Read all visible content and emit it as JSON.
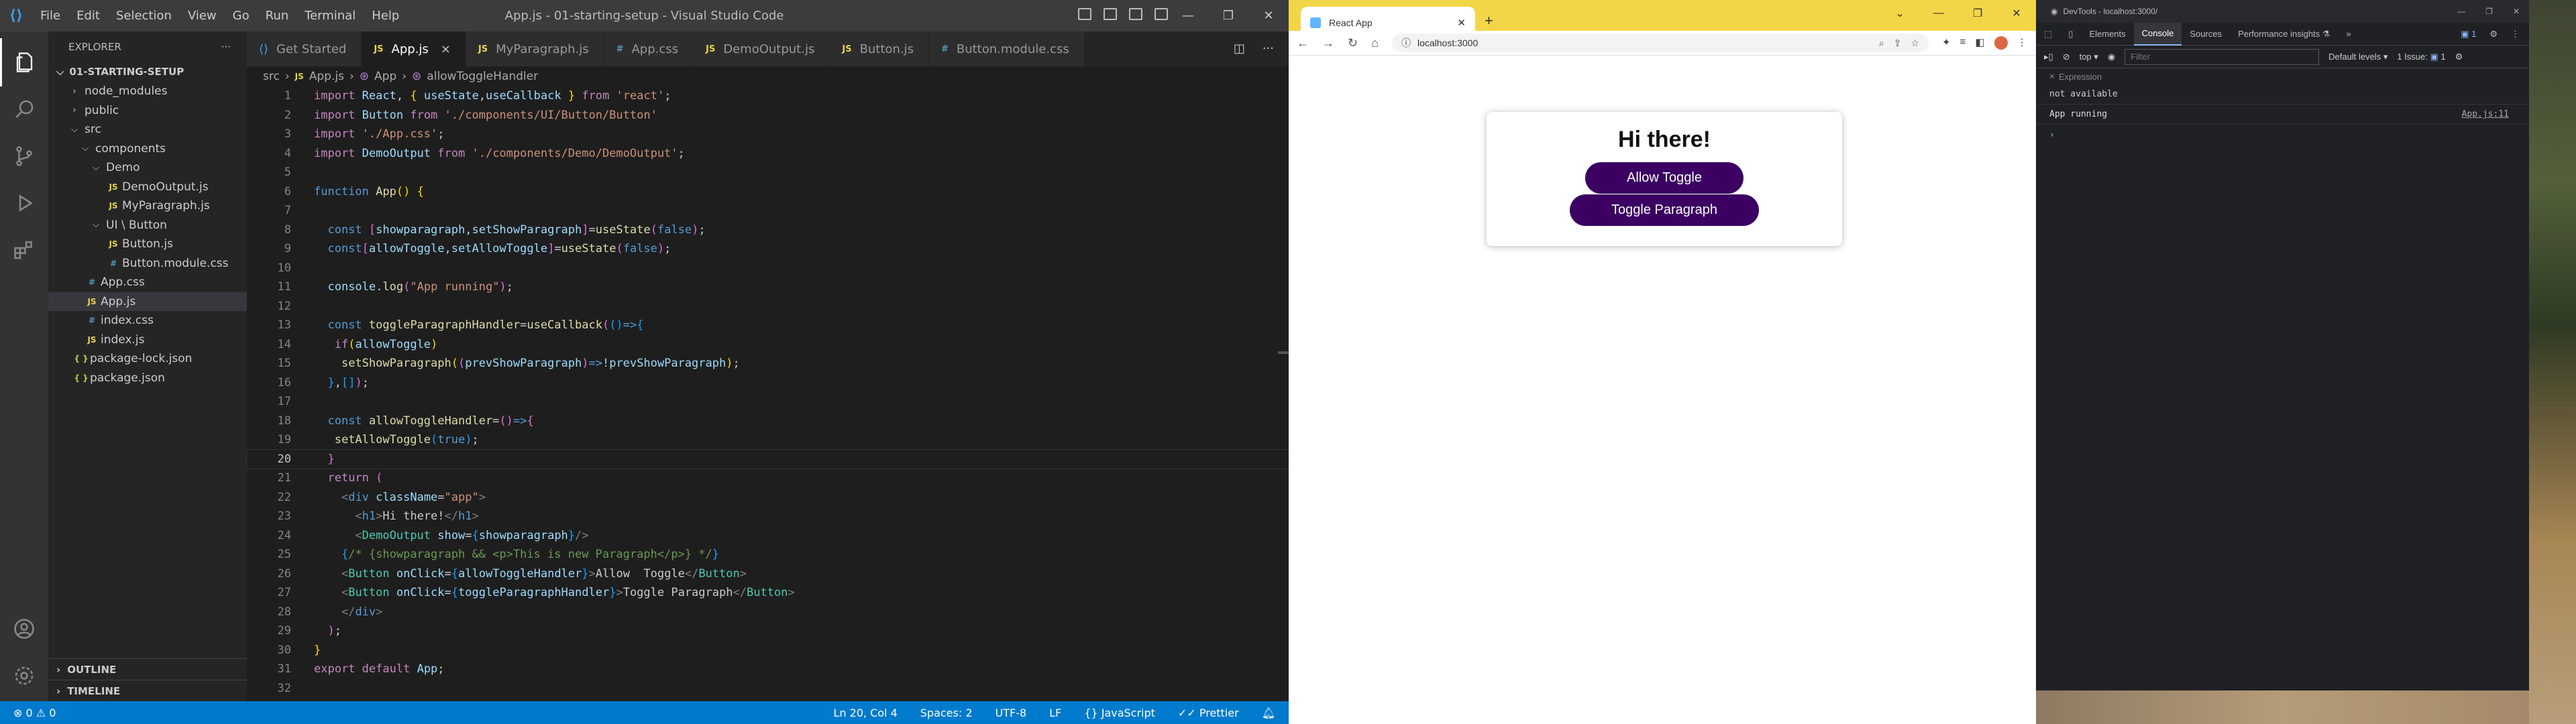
{
  "vscode": {
    "title": "App.js - 01-starting-setup - Visual Studio Code",
    "menu": [
      "File",
      "Edit",
      "Selection",
      "View",
      "Go",
      "Run",
      "Terminal",
      "Help"
    ],
    "explorer_title": "EXPLORER",
    "root_folder": "01-STARTING-SETUP",
    "tree": [
      {
        "label": "node_modules",
        "kind": "folder",
        "depth": 1,
        "open": false
      },
      {
        "label": "public",
        "kind": "folder",
        "depth": 1,
        "open": false
      },
      {
        "label": "src",
        "kind": "folder",
        "depth": 1,
        "open": true
      },
      {
        "label": "components",
        "kind": "folder",
        "depth": 2,
        "open": true
      },
      {
        "label": "Demo",
        "kind": "folder",
        "depth": 3,
        "open": true
      },
      {
        "label": "DemoOutput.js",
        "kind": "js",
        "depth": 4
      },
      {
        "label": "MyParagraph.js",
        "kind": "js",
        "depth": 4
      },
      {
        "label": "UI \\ Button",
        "kind": "folder",
        "depth": 3,
        "open": true
      },
      {
        "label": "Button.js",
        "kind": "js",
        "depth": 4
      },
      {
        "label": "Button.module.css",
        "kind": "css",
        "depth": 4
      },
      {
        "label": "App.css",
        "kind": "css",
        "depth": 2
      },
      {
        "label": "App.js",
        "kind": "js",
        "depth": 2,
        "selected": true
      },
      {
        "label": "index.css",
        "kind": "css",
        "depth": 2
      },
      {
        "label": "index.js",
        "kind": "js",
        "depth": 2
      },
      {
        "label": "package-lock.json",
        "kind": "json",
        "depth": 1
      },
      {
        "label": "package.json",
        "kind": "json",
        "depth": 1
      }
    ],
    "outline_label": "OUTLINE",
    "timeline_label": "TIMELINE",
    "tabs": [
      {
        "label": "Get Started",
        "icon": "vscode",
        "active": false
      },
      {
        "label": "App.js",
        "icon": "js",
        "active": true
      },
      {
        "label": "MyParagraph.js",
        "icon": "js",
        "active": false
      },
      {
        "label": "App.css",
        "icon": "css",
        "active": false
      },
      {
        "label": "DemoOutput.js",
        "icon": "js",
        "active": false
      },
      {
        "label": "Button.js",
        "icon": "js",
        "active": false
      },
      {
        "label": "Button.module.css",
        "icon": "css",
        "active": false
      }
    ],
    "breadcrumb": [
      "src",
      "App.js",
      "App",
      "allowToggleHandler"
    ],
    "current_line": 20,
    "status": {
      "errors": "0",
      "warnings": "0",
      "position": "Ln 20, Col 4",
      "spaces": "Spaces: 2",
      "encoding": "UTF-8",
      "eol": "LF",
      "language": "JavaScript",
      "formatter": "Prettier"
    }
  },
  "chrome": {
    "tab_title": "React App",
    "url": "localhost:3000",
    "page": {
      "heading": "Hi there!",
      "buttons": [
        "Allow Toggle",
        "Toggle Paragraph"
      ],
      "button_color": "#3b0062"
    }
  },
  "devtools": {
    "title": "DevTools - localhost:3000/",
    "tabs": [
      "Elements",
      "Console",
      "Sources",
      "Performance insights"
    ],
    "active_tab": "Console",
    "context": "top",
    "filter_placeholder": "Filter",
    "levels": "Default levels",
    "issues": "1 Issue:",
    "issues_count": "1",
    "messages_count": "1",
    "expression_label": "Expression",
    "expression_value": "not available",
    "log_message": "App running",
    "log_source": "App.js:11"
  }
}
